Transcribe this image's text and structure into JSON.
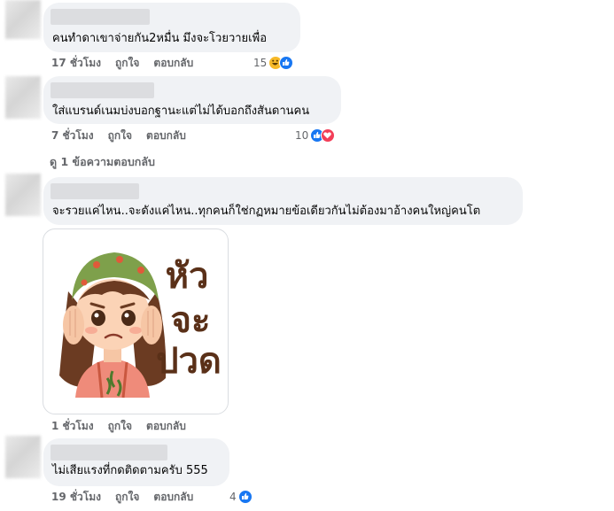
{
  "comments": [
    {
      "text": "คนทำดาเขาจ่ายกัน2หมื่น มึงจะโวยวายเพื่อ",
      "time": "17 ชั่วโมง",
      "like": "ถูกใจ",
      "reply": "ตอบกลับ",
      "reaction_count": "15",
      "reactions": [
        "haha-icon",
        "like-icon"
      ]
    },
    {
      "text": "ใส่แบรนด์เนมบ่งบอกฐานะแต่ไม่ได้บอกถึงสันดานคน",
      "time": "7 ชั่วโมง",
      "like": "ถูกใจ",
      "reply": "ตอบกลับ",
      "reaction_count": "10",
      "reactions": [
        "like-icon",
        "love-icon"
      ],
      "view_replies": "ดู 1 ข้อความตอบกลับ"
    },
    {
      "text": "จะรวยแค่ไหน..จะดังแค่ไหน..ทุกคนก็ใช่กฏหมายข้อเดียวกันไม่ต้องมาอ้างคนใหญ่คนโต",
      "sticker_text": [
        "หัว",
        "จะ",
        "ปวด"
      ],
      "time": "1 ชั่วโมง",
      "like": "ถูกใจ",
      "reply": "ตอบกลับ"
    },
    {
      "text": "ไม่เสียแรงที่กดติดตามครับ 555",
      "time": "19 ชั่วโมง",
      "like": "ถูกใจ",
      "reply": "ตอบกลับ",
      "reaction_count": "4",
      "reactions": [
        "like-icon"
      ]
    }
  ],
  "colors": {
    "bubble": "#f0f2f5",
    "meta_text": "#65676b",
    "like_blue": "#1877f2",
    "love_red": "#f33e58",
    "haha_yellow": "#f7b928"
  }
}
